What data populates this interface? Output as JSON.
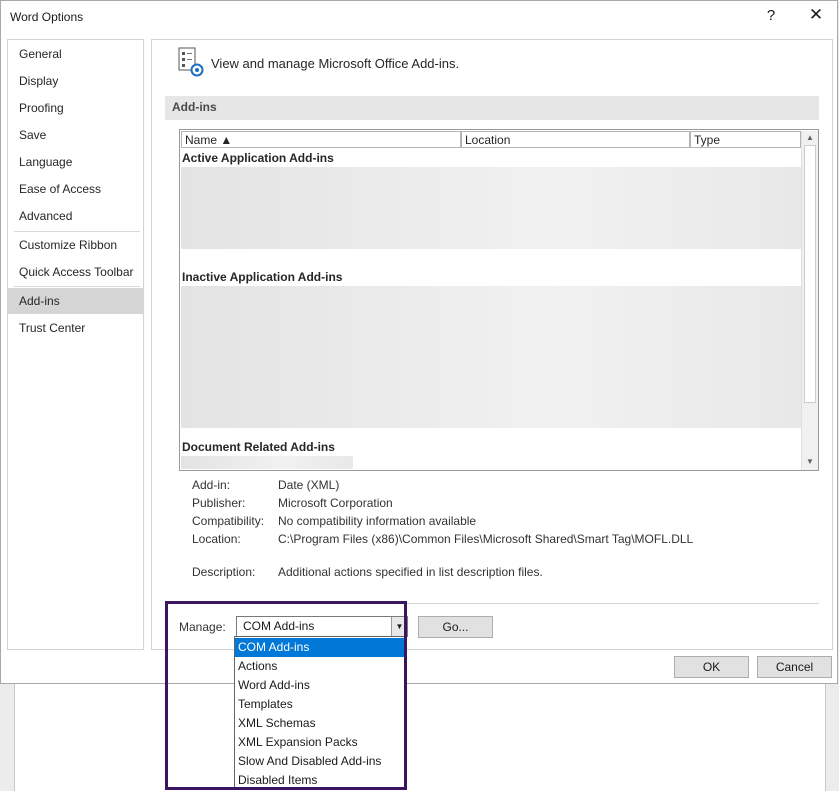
{
  "window": {
    "title": "Word Options",
    "help_glyph": "?",
    "close_glyph": "✕"
  },
  "sidebar": {
    "items": [
      {
        "label": "General"
      },
      {
        "label": "Display"
      },
      {
        "label": "Proofing"
      },
      {
        "label": "Save"
      },
      {
        "label": "Language"
      },
      {
        "label": "Ease of Access"
      },
      {
        "label": "Advanced"
      },
      {
        "label": "Customize Ribbon"
      },
      {
        "label": "Quick Access Toolbar"
      },
      {
        "label": "Add-ins"
      },
      {
        "label": "Trust Center"
      }
    ],
    "selected": "Add-ins"
  },
  "header": {
    "text": "View and manage Microsoft Office Add-ins."
  },
  "addins": {
    "section_title": "Add-ins",
    "columns": [
      "Name ▲",
      "Location",
      "Type"
    ],
    "groups": [
      "Active Application Add-ins",
      "Inactive Application Add-ins",
      "Document Related Add-ins"
    ]
  },
  "details": {
    "addin_label": "Add-in:",
    "addin_value": "Date (XML)",
    "publisher_label": "Publisher:",
    "publisher_value": "Microsoft Corporation",
    "compat_label": "Compatibility:",
    "compat_value": "No compatibility information available",
    "location_label": "Location:",
    "location_value": "C:\\Program Files (x86)\\Common Files\\Microsoft Shared\\Smart Tag\\MOFL.DLL",
    "description_label": "Description:",
    "description_value": "Additional actions specified in list description files."
  },
  "manage": {
    "label": "Manage:",
    "selected": "COM Add-ins",
    "go_label": "Go...",
    "options": [
      "COM Add-ins",
      "Actions",
      "Word Add-ins",
      "Templates",
      "XML Schemas",
      "XML Expansion Packs",
      "Slow And Disabled Add-ins",
      "Disabled Items"
    ]
  },
  "footer": {
    "ok_label": "OK",
    "cancel_label": "Cancel"
  },
  "colors": {
    "selection": "#0078d7",
    "annotation": "#3b1560",
    "nav_selected": "#d5d5d5"
  },
  "icons": {
    "help": "help-icon",
    "close": "close-icon",
    "addins": "addins-gear-icon",
    "combo": "chevron-down-icon",
    "sort": "sort-ascending-icon"
  }
}
